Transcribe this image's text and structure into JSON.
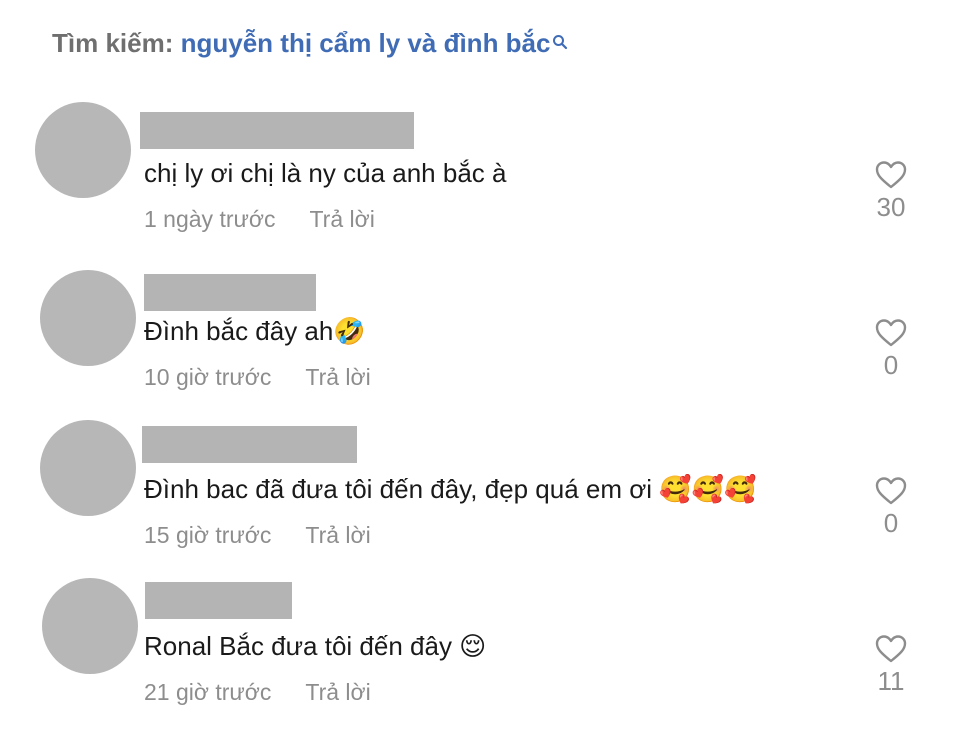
{
  "search": {
    "label": "Tìm kiếm:",
    "query": "nguyễn thị cẩm ly và đình bắc",
    "icon": "search-icon"
  },
  "reply_label": "Trả lời",
  "comments": [
    {
      "text": "chị ly ơi chị là ny của anh bắc à",
      "time": "1 ngày trước",
      "likes": "30"
    },
    {
      "text": "Đình bắc đây ah🤣",
      "time": "10 giờ trước",
      "likes": "0"
    },
    {
      "text": "Đình bac đã đưa tôi đến đây, đẹp quá em ơi 🥰🥰🥰",
      "time": "15 giờ trước",
      "likes": "0"
    },
    {
      "text": "Ronal Bắc đưa tôi đến đây 😌",
      "time": "21 giờ trước",
      "likes": "11"
    }
  ],
  "colors": {
    "query": "#3f6cb5",
    "label": "#6f6f6f",
    "meta": "#8d8d8d",
    "placeholder": "#b4b4b4"
  }
}
